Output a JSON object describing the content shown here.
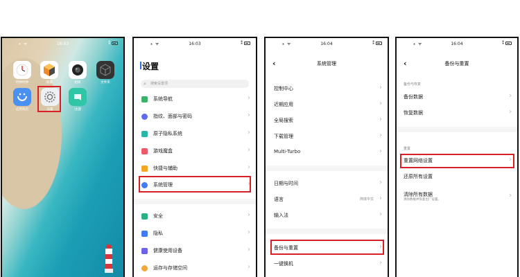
{
  "phone1": {
    "status": {
      "time": "16:03",
      "left": "⁎ ᯤ",
      "right": "⁑"
    },
    "apps": [
      {
        "label": "时钟时钟",
        "icon": "clock-icon"
      },
      {
        "label": "i管家",
        "icon": "cube-orange-icon"
      },
      {
        "label": "相机",
        "icon": "camera-icon"
      },
      {
        "label": "文件夹",
        "icon": "cube-dark-icon"
      },
      {
        "label": "应用商店",
        "icon": "store-icon"
      },
      {
        "label": "设置",
        "icon": "gear-icon"
      },
      {
        "label": "i主题",
        "icon": "theme-icon"
      }
    ]
  },
  "phone2": {
    "status": {
      "time": "16:03",
      "left": "⁎ ᯤ",
      "right": "⁑"
    },
    "title": "设置",
    "search_placeholder": "搜索设置项",
    "items": [
      {
        "label": "系统导航",
        "color": "#3bb36b"
      },
      {
        "label": "指纹、面部与密码",
        "color": "#5b6cf0"
      },
      {
        "label": "原子隐私系统",
        "color": "#26b7a8"
      },
      {
        "label": "游戏魔盒",
        "color": "#ef5a6a"
      },
      {
        "label": "快捷与辅助",
        "color": "#f5a623"
      },
      {
        "label": "系统管理",
        "color": "#3f7df2"
      },
      {
        "label": "安全",
        "color": "#29b27f"
      },
      {
        "label": "隐私",
        "color": "#3f7df2"
      },
      {
        "label": "健康使用设备",
        "color": "#6c63e6"
      },
      {
        "label": "运存与存储空间",
        "color": "#f2a93b"
      }
    ]
  },
  "phone3": {
    "status": {
      "time": "16:04",
      "left": "⁎ ᯤ",
      "right": "⁑"
    },
    "title": "系统管理",
    "group1": [
      "控制中心",
      "近期应用",
      "全局搜索",
      "下载管理",
      "Multi-Turbo"
    ],
    "group2": [
      {
        "label": "日期与时间",
        "value": ""
      },
      {
        "label": "语言",
        "value": "简体中文"
      },
      {
        "label": "输入法",
        "value": ""
      }
    ],
    "group3": [
      "备份与重置",
      "一键换机"
    ]
  },
  "phone4": {
    "status": {
      "time": "16:04",
      "left": "⁎ ᯤ",
      "right": "⁑"
    },
    "title": "备份与重置",
    "section1": "备份与恢复",
    "backup_items": [
      "备份数据",
      "恢复数据"
    ],
    "section2": "重置",
    "reset_items": [
      {
        "label": "重置网络设置",
        "sub": ""
      },
      {
        "label": "还原所有设置",
        "sub": ""
      },
      {
        "label": "清除所有数据",
        "sub": "清除数据并恢复出厂设置。"
      }
    ]
  }
}
